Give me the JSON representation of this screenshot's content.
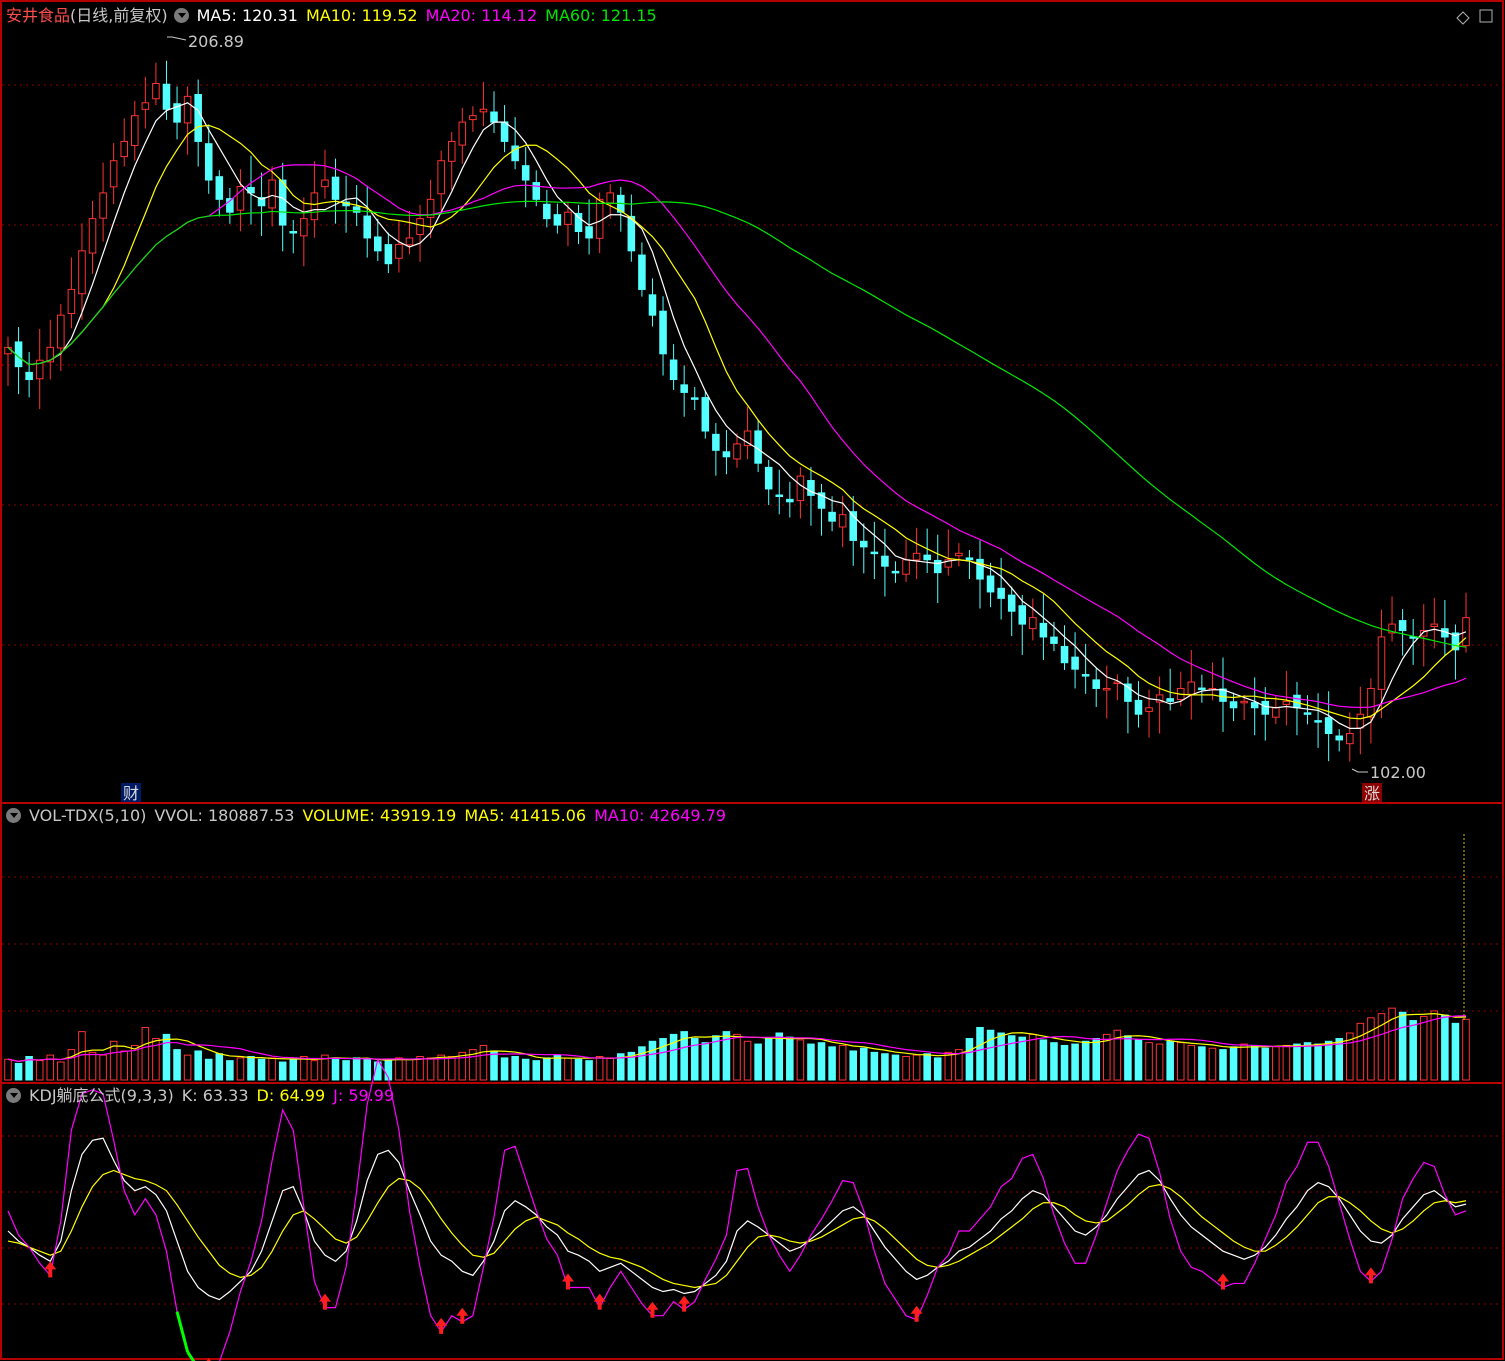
{
  "colors": {
    "up": "#ff3232",
    "down": "#54ffff",
    "ma5": "#ffffff",
    "ma10": "#ffff00",
    "ma20": "#ff00ff",
    "ma60": "#00e600",
    "grid": "#8b0000",
    "border": "#b40000"
  },
  "main_panel": {
    "stock_name": "安井食品",
    "period": "(日线,前复权)",
    "ma5": "MA5: 120.31",
    "ma10": "MA10: 119.52",
    "ma20": "MA20: 114.12",
    "ma60": "MA60: 121.15",
    "high_label": "206.89",
    "low_label": "102.00",
    "badge_cai": "财",
    "badge_zhang": "涨"
  },
  "vol_panel": {
    "name": "VOL-TDX(5,10)",
    "vvol": "VVOL: 180887.53",
    "volume": "VOLUME: 43919.19",
    "ma5": "MA5: 41415.06",
    "ma10": "MA10: 42649.79"
  },
  "kdj_panel": {
    "name": "KDJ躺底公式(9,3,3)",
    "k": "K: 63.33",
    "d": "D: 64.99",
    "j": "J: 59.99"
  },
  "chart_data": [
    {
      "type": "candlestick",
      "name": "price",
      "ylim": [
        95,
        212
      ],
      "high_mark": 206.89,
      "low_mark": 102.0,
      "closes": [
        163,
        160,
        158,
        161,
        163,
        168,
        172,
        178,
        183,
        187,
        192,
        195,
        199,
        201,
        204,
        200,
        198,
        202,
        195,
        189,
        186,
        184,
        188,
        187,
        185,
        189,
        182,
        181,
        183,
        187,
        189,
        186,
        185,
        184,
        180,
        178,
        176,
        179,
        180,
        183,
        186,
        192,
        195,
        198,
        199,
        200,
        198,
        195,
        192,
        189,
        186,
        183,
        182,
        184,
        181,
        180,
        186,
        187,
        184,
        178,
        172,
        168,
        162,
        158,
        156,
        155,
        150,
        147,
        146,
        148,
        150,
        145,
        141,
        140,
        139,
        143,
        140,
        138,
        136,
        137,
        133,
        132,
        131,
        129,
        128,
        130,
        131,
        130,
        128,
        130,
        131,
        130,
        127,
        125,
        124,
        122,
        120,
        121,
        118,
        117,
        114,
        113,
        112,
        110,
        110,
        111,
        108,
        106,
        107,
        109,
        108,
        110,
        111,
        110,
        110,
        108,
        107,
        108,
        107,
        106,
        107,
        108,
        107,
        106,
        105,
        103,
        102,
        103,
        106,
        110,
        118,
        120,
        119,
        118,
        119,
        120,
        118,
        116,
        121
      ]
    },
    {
      "type": "bar",
      "name": "volume",
      "ylim": [
        0,
        180887.53
      ],
      "values": [
        15000,
        12000,
        17000,
        14000,
        18000,
        13000,
        22000,
        35000,
        20000,
        18000,
        28000,
        21000,
        25000,
        38000,
        30000,
        33000,
        22000,
        18000,
        21000,
        15000,
        19000,
        14000,
        16000,
        17000,
        15000,
        16000,
        13000,
        15000,
        17000,
        14000,
        18000,
        16000,
        14000,
        16000,
        15000,
        13000,
        14000,
        16000,
        15000,
        17000,
        16000,
        18000,
        17000,
        20000,
        22000,
        25000,
        21000,
        16000,
        17000,
        15000,
        14000,
        16000,
        18000,
        16000,
        15000,
        14000,
        17000,
        16000,
        19000,
        20000,
        24000,
        28000,
        30000,
        33000,
        35000,
        30000,
        27000,
        32000,
        35000,
        33000,
        28000,
        26000,
        30000,
        34000,
        31000,
        29000,
        26000,
        27000,
        24000,
        25000,
        21000,
        23000,
        20000,
        19000,
        18000,
        17000,
        18000,
        19000,
        16000,
        20000,
        22000,
        30000,
        38000,
        36000,
        34000,
        32000,
        31000,
        33000,
        29000,
        27000,
        25000,
        26000,
        28000,
        30000,
        33000,
        36000,
        32000,
        29000,
        27000,
        26000,
        28000,
        27000,
        25000,
        24000,
        23000,
        22000,
        24000,
        26000,
        25000,
        23000,
        24000,
        25000,
        26000,
        27000,
        26000,
        28000,
        30000,
        34000,
        41000,
        45000,
        48000,
        52000,
        49000,
        43000,
        46000,
        50000,
        47000,
        41000,
        43919.19
      ]
    },
    {
      "type": "line",
      "name": "KDJ",
      "ylim": [
        -10,
        110
      ],
      "series": [
        {
          "name": "K",
          "values": [
            50,
            45,
            42,
            38,
            35,
            45,
            70,
            88,
            95,
            96,
            85,
            75,
            70,
            72,
            68,
            60,
            45,
            30,
            22,
            18,
            16,
            20,
            25,
            30,
            40,
            55,
            70,
            72,
            60,
            45,
            38,
            35,
            40,
            55,
            75,
            88,
            90,
            84,
            70,
            58,
            45,
            38,
            35,
            30,
            28,
            35,
            45,
            60,
            65,
            62,
            58,
            52,
            48,
            40,
            38,
            35,
            30,
            32,
            34,
            30,
            26,
            22,
            20,
            21,
            19,
            20,
            24,
            28,
            35,
            50,
            55,
            52,
            48,
            44,
            40,
            42,
            46,
            50,
            55,
            60,
            62,
            58,
            50,
            42,
            36,
            30,
            26,
            28,
            32,
            35,
            40,
            42,
            46,
            50,
            56,
            60,
            66,
            70,
            68,
            62,
            56,
            50,
            48,
            52,
            58,
            66,
            72,
            78,
            80,
            75,
            66,
            58,
            52,
            48,
            44,
            40,
            38,
            36,
            38,
            42,
            48,
            56,
            62,
            70,
            74,
            72,
            66,
            58,
            50,
            45,
            44,
            48,
            56,
            62,
            68,
            70,
            66,
            62,
            63.33
          ]
        },
        {
          "name": "D",
          "values": [
            45,
            44,
            42,
            40,
            38,
            40,
            50,
            62,
            72,
            78,
            80,
            78,
            76,
            75,
            73,
            70,
            63,
            55,
            47,
            40,
            33,
            29,
            27,
            28,
            32,
            40,
            50,
            58,
            60,
            56,
            51,
            46,
            44,
            47,
            55,
            64,
            72,
            76,
            75,
            71,
            64,
            56,
            49,
            43,
            38,
            37,
            39,
            45,
            51,
            55,
            57,
            55,
            53,
            49,
            46,
            42,
            39,
            37,
            36,
            34,
            32,
            29,
            26,
            24,
            23,
            22,
            23,
            24,
            28,
            35,
            42,
            47,
            48,
            47,
            45,
            44,
            45,
            47,
            50,
            53,
            56,
            57,
            55,
            51,
            46,
            41,
            36,
            33,
            32,
            33,
            35,
            38,
            41,
            44,
            48,
            52,
            56,
            61,
            64,
            64,
            62,
            58,
            55,
            54,
            55,
            59,
            63,
            68,
            72,
            73,
            71,
            67,
            62,
            57,
            53,
            49,
            45,
            42,
            40,
            40,
            43,
            47,
            52,
            58,
            64,
            67,
            67,
            64,
            60,
            55,
            51,
            49,
            51,
            55,
            60,
            64,
            65,
            64,
            64.99
          ]
        },
        {
          "name": "J",
          "values": [
            60,
            48,
            42,
            34,
            28,
            55,
            100,
            118,
            120,
            118,
            95,
            70,
            58,
            66,
            58,
            40,
            10,
            -10,
            -18,
            -20,
            -15,
            0,
            20,
            35,
            55,
            85,
            110,
            100,
            62,
            25,
            12,
            12,
            32,
            70,
            113,
            135,
            126,
            100,
            60,
            32,
            8,
            0,
            8,
            5,
            8,
            32,
            57,
            90,
            92,
            76,
            60,
            46,
            38,
            22,
            22,
            22,
            12,
            22,
            30,
            22,
            14,
            8,
            8,
            15,
            11,
            15,
            26,
            36,
            48,
            80,
            81,
            62,
            48,
            38,
            30,
            38,
            48,
            56,
            65,
            75,
            74,
            60,
            40,
            24,
            16,
            8,
            6,
            18,
            32,
            38,
            50,
            50,
            56,
            62,
            72,
            76,
            86,
            88,
            76,
            58,
            44,
            34,
            34,
            48,
            64,
            80,
            90,
            98,
            96,
            79,
            56,
            40,
            32,
            30,
            26,
            22,
            24,
            24,
            34,
            46,
            58,
            74,
            82,
            94,
            94,
            82,
            64,
            46,
            30,
            25,
            30,
            46,
            66,
            76,
            84,
            82,
            68,
            58,
            59.99
          ]
        }
      ]
    }
  ]
}
